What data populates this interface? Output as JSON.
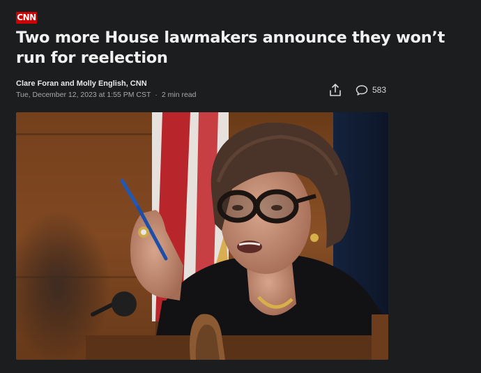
{
  "brand": {
    "logo_text": "CNN",
    "color": "#cc0000"
  },
  "article": {
    "headline": "Two more House lawmakers announce they won’t run for reelection",
    "byline": "Clare Foran and Molly English, CNN",
    "date": "Tue, December 12, 2023 at 1:55 PM CST",
    "separator": "·",
    "read_time": "2 min read"
  },
  "actions": {
    "share_icon": "share-icon",
    "comment_icon": "comment-bubble-icon",
    "comment_count": "583"
  },
  "hero_image": {
    "subject": "woman with tortoiseshell glasses holding a blue pen speaking at a hearing"
  },
  "colors": {
    "background": "#1c1d1f",
    "text": "#f1f1f1",
    "meta": "#a9a9ab"
  }
}
